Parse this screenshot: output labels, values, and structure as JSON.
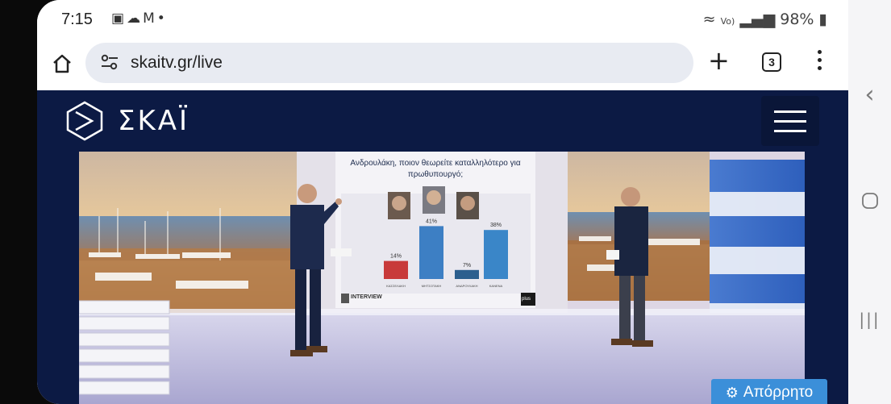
{
  "status_bar": {
    "time": "7:15",
    "notif_icons": [
      "image-icon",
      "cloud-icon",
      "gmail-icon",
      "dot-icon"
    ],
    "battery": "98%"
  },
  "browser": {
    "url": "skaitv.gr/live",
    "tab_count": "3"
  },
  "site": {
    "logo_text": "ΣΚΑΪ"
  },
  "video": {
    "poll_question": "Ανδρουλάκη, ποιον θεωρείτε καταλληλότερο για πρωθυπουργό;",
    "poll_bars": [
      {
        "label": "ΚΑΣΣΕΛΑΚΗ",
        "value": "14%",
        "pct": 14,
        "color": "#c83a3a"
      },
      {
        "label": "ΜΗΤΣΟΤΑΚΗ",
        "value": "41%",
        "pct": 41,
        "color": "#3d7fc4"
      },
      {
        "label": "ΑΝΔΡΟΥΛΑΚΗ",
        "value": "7%",
        "pct": 7,
        "color": "#2c5f8e"
      },
      {
        "label": "ΚΑΝΕΝΑ",
        "value": "38%",
        "pct": 38,
        "color": "#3a86c8"
      }
    ],
    "pollster": "INTERVIEW",
    "channel_bug": "plus"
  },
  "cta_button": {
    "label": "Απόρρητο"
  }
}
